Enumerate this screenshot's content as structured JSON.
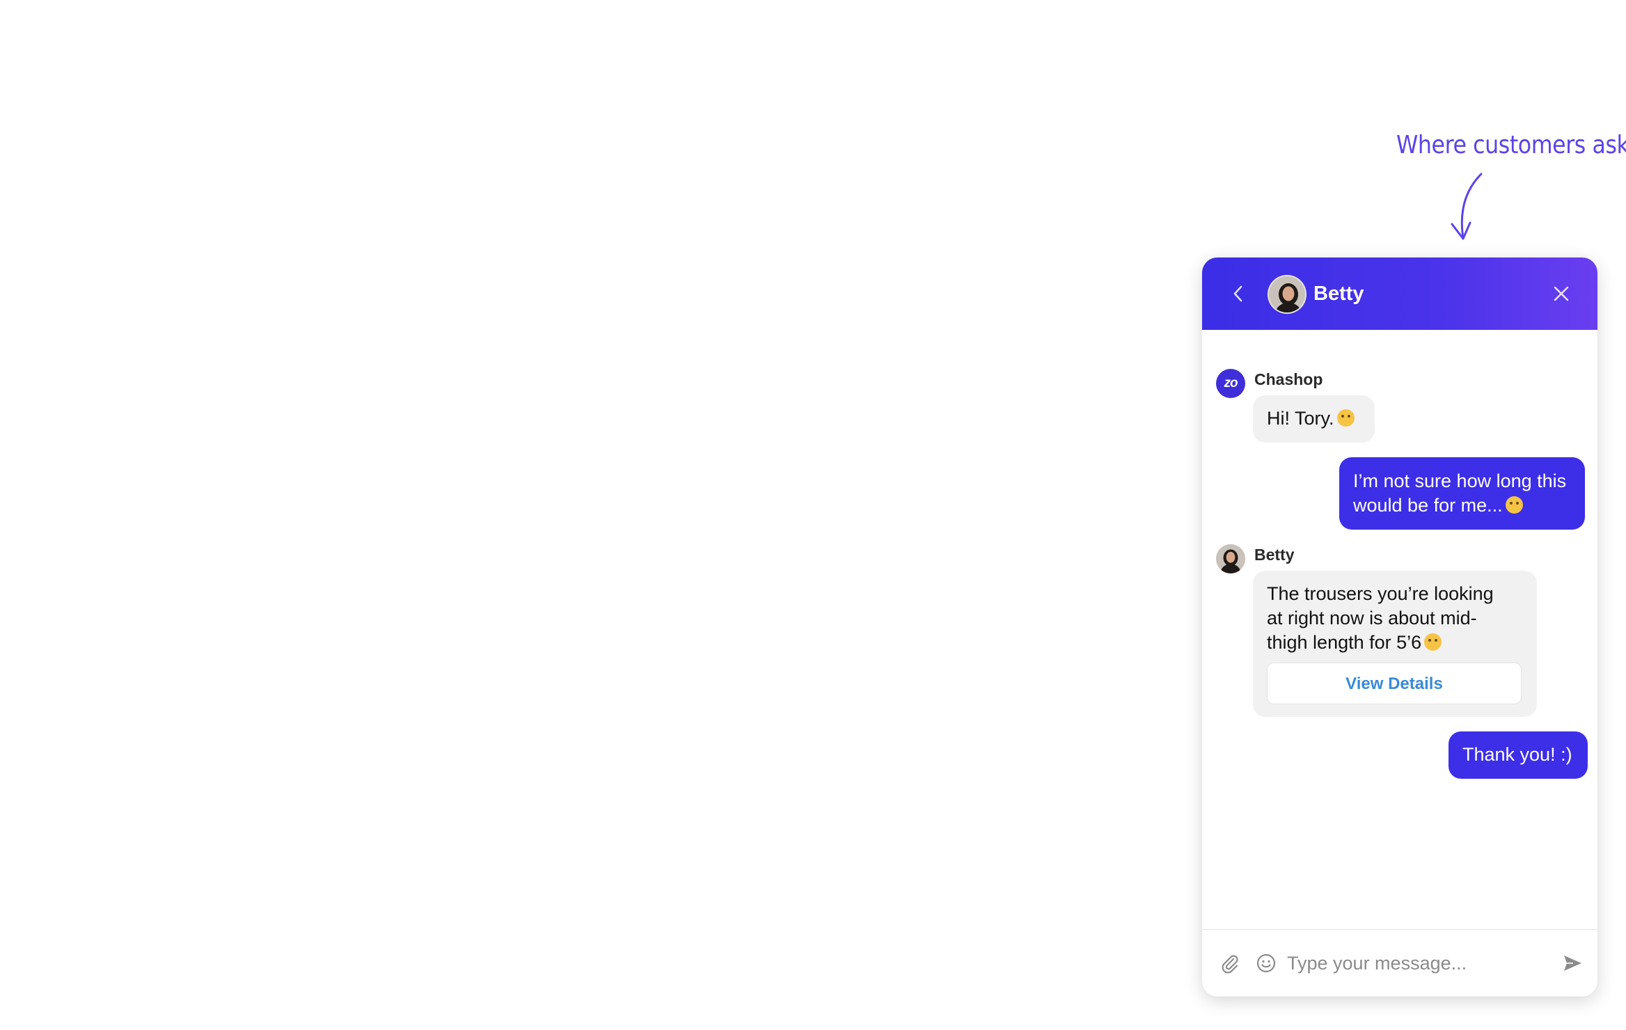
{
  "annotation": {
    "text": "Where customers ask"
  },
  "chat": {
    "header": {
      "agent_name": "Betty"
    },
    "messages": [
      {
        "direction": "incoming",
        "sender": "Chashop",
        "avatar": "zo",
        "text": "Hi! Tory.",
        "emoji": "waving-hand"
      },
      {
        "direction": "outgoing",
        "text_line1": "I’m not sure how long this",
        "text_line2": "would be for me...",
        "emoji": "thinking-face"
      },
      {
        "direction": "incoming",
        "sender": "Betty",
        "text_line1": "The trousers you’re looking",
        "text_line2": "at right now is about mid-",
        "text_line3": "thigh length for 5’6",
        "emoji": "smiling-face",
        "button_label": "View Details"
      },
      {
        "direction": "outgoing",
        "text": "Thank you! :)"
      }
    ],
    "composer": {
      "placeholder": "Type your message..."
    }
  },
  "colors": {
    "accent": "#3d2ee8",
    "annotation": "#5a44e8",
    "link": "#3a8ad6",
    "incoming_bubble": "#f1f1f1"
  }
}
